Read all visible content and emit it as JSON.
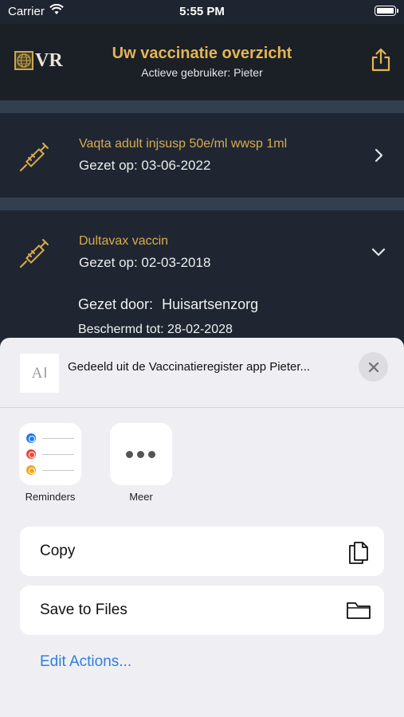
{
  "status_bar": {
    "carrier": "Carrier",
    "time": "5:55 PM"
  },
  "header": {
    "logo_text": "VR",
    "title": "Uw vaccinatie overzicht",
    "subtitle": "Actieve gebruiker: Pieter"
  },
  "vaccinations": [
    {
      "name": "Vaqta adult injsusp 50e/ml wwsp 1ml",
      "date": "Gezet op: 03-06-2022"
    },
    {
      "name": "Dultavax vaccin",
      "date": "Gezet op: 02-03-2018",
      "given_by_label": "Gezet door:",
      "given_by": "Huisartsenzorg",
      "protected_until": "Beschermd tot: 28-02-2028"
    }
  ],
  "share_sheet": {
    "title": "Gedeeld uit de Vaccinatieregister app Pieter...",
    "apps": [
      {
        "label": "Reminders",
        "icon": "reminders-icon"
      },
      {
        "label": "Meer",
        "icon": "more-icon"
      }
    ],
    "actions": [
      {
        "label": "Copy",
        "icon": "copy-icon"
      },
      {
        "label": "Save to Files",
        "icon": "folder-icon"
      }
    ],
    "edit_label": "Edit Actions..."
  },
  "colors": {
    "accent_gold": "#e3b654",
    "link_blue": "#2f7fe2",
    "card_bg": "#1f2632"
  }
}
